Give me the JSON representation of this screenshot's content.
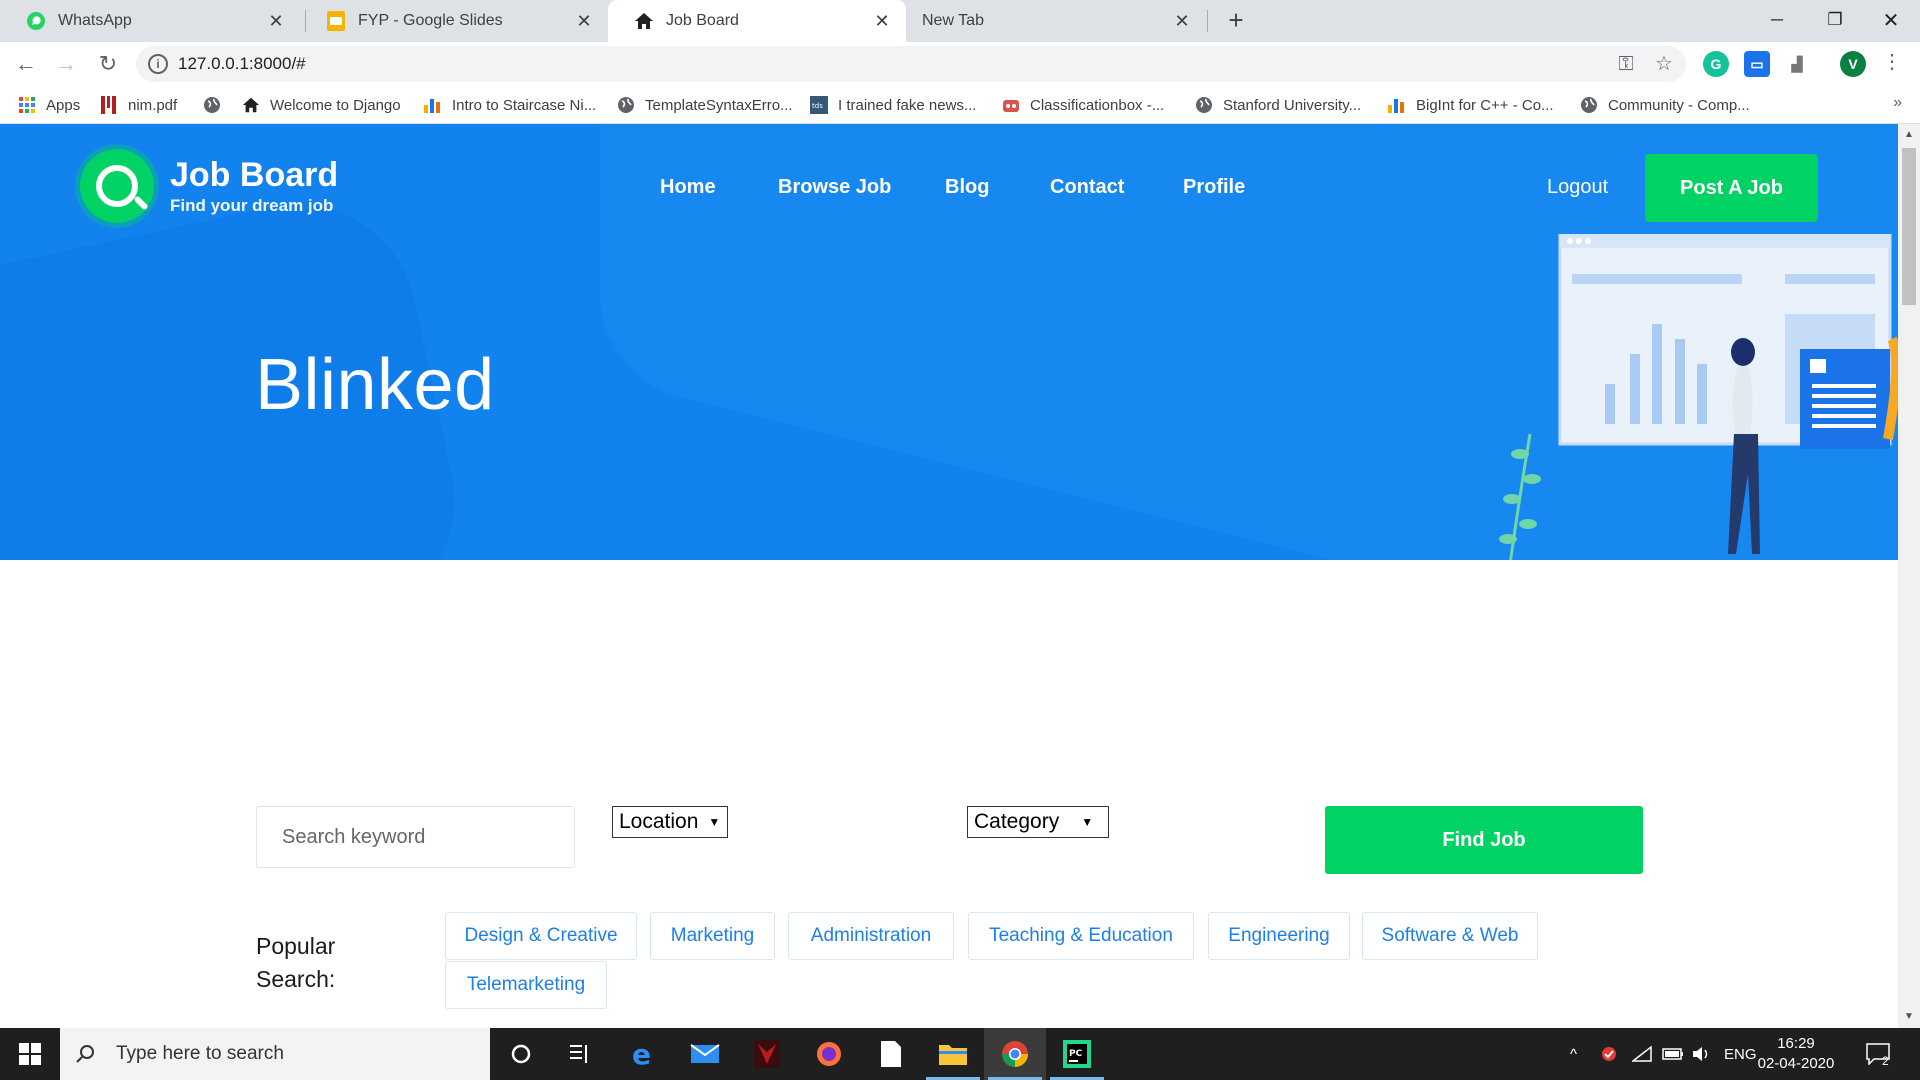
{
  "browser": {
    "tabs": [
      {
        "title": "WhatsApp"
      },
      {
        "title": "FYP - Google Slides"
      },
      {
        "title": "Job Board"
      },
      {
        "title": "New Tab"
      }
    ],
    "url": "127.0.0.1:8000/#",
    "bookmarks": [
      {
        "label": "Apps"
      },
      {
        "label": "nim.pdf"
      },
      {
        "label": "Welcome to Django"
      },
      {
        "label": "Intro to Staircase Ni..."
      },
      {
        "label": "TemplateSyntaxErro..."
      },
      {
        "label": "I trained fake news..."
      },
      {
        "label": "Classificationbox -..."
      },
      {
        "label": "Stanford University..."
      },
      {
        "label": "BigInt for C++ - Co..."
      },
      {
        "label": "Community - Comp..."
      }
    ],
    "profile_initial": "V"
  },
  "site": {
    "logo_title": "Job Board",
    "logo_subtitle": "Find your dream job",
    "nav": [
      {
        "label": "Home"
      },
      {
        "label": "Browse Job"
      },
      {
        "label": "Blog"
      },
      {
        "label": "Contact"
      },
      {
        "label": "Profile"
      }
    ],
    "logout_label": "Logout",
    "post_job_label": "Post A Job",
    "hero_title": "Blinked"
  },
  "search": {
    "keyword_placeholder": "Search keyword",
    "location_label": "Location",
    "category_label": "Category",
    "find_label": "Find Job",
    "popular_label_line1": "Popular",
    "popular_label_line2": "Search:",
    "popular_tags": [
      "Design & Creative",
      "Marketing",
      "Administration",
      "Teaching & Education",
      "Engineering",
      "Software & Web",
      "Telemarketing"
    ]
  },
  "taskbar": {
    "search_placeholder": "Type here to search",
    "language": "ENG",
    "time": "16:29",
    "date": "02-04-2020",
    "notification_count": "2"
  },
  "colors": {
    "hero_blue": "#1182ee",
    "accent_green": "#00d363",
    "tag_text": "#1e7fea"
  }
}
